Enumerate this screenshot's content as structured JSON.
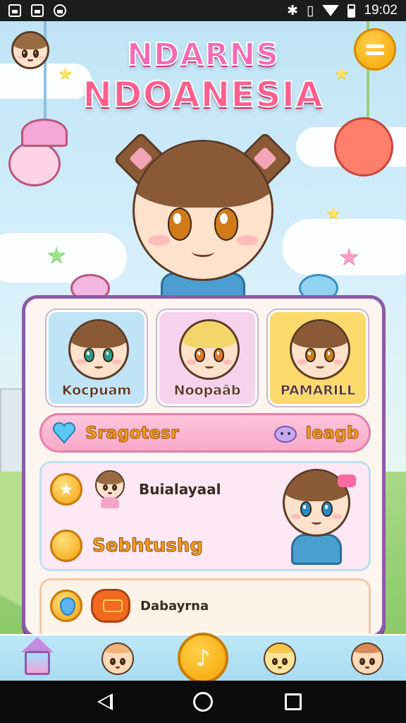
{
  "status_bar": {
    "time": "19:02",
    "icons": [
      "image-icon",
      "m-icon",
      "gear-icon",
      "bluetooth-icon",
      "vibrate-icon",
      "wifi-icon",
      "battery-icon"
    ]
  },
  "header": {
    "title_line1": "NDARNS",
    "title_line2": "NDOANESIA"
  },
  "characters": [
    {
      "name": "Kocpuam",
      "bg": "#bfe4f6",
      "hair": "#8a5a36"
    },
    {
      "name": "Noopaāb",
      "bg": "#f7d2ec",
      "hair": "#f2d66a"
    },
    {
      "name": "PAMARILL",
      "bg": "#fbd96a",
      "hair": "#8a5a36"
    }
  ],
  "pink_bar": {
    "left_label": "Sragotesr",
    "right_label": "Ieagb"
  },
  "list": {
    "row1_label": "Buialayaal",
    "row2_label": "Sebhtushg"
  },
  "list2": {
    "row1_label": "Dabayrna"
  },
  "colors": {
    "panel_border": "#8e5aa8",
    "accent_yellow": "#f5a300",
    "accent_pink": "#f7a8c8"
  }
}
